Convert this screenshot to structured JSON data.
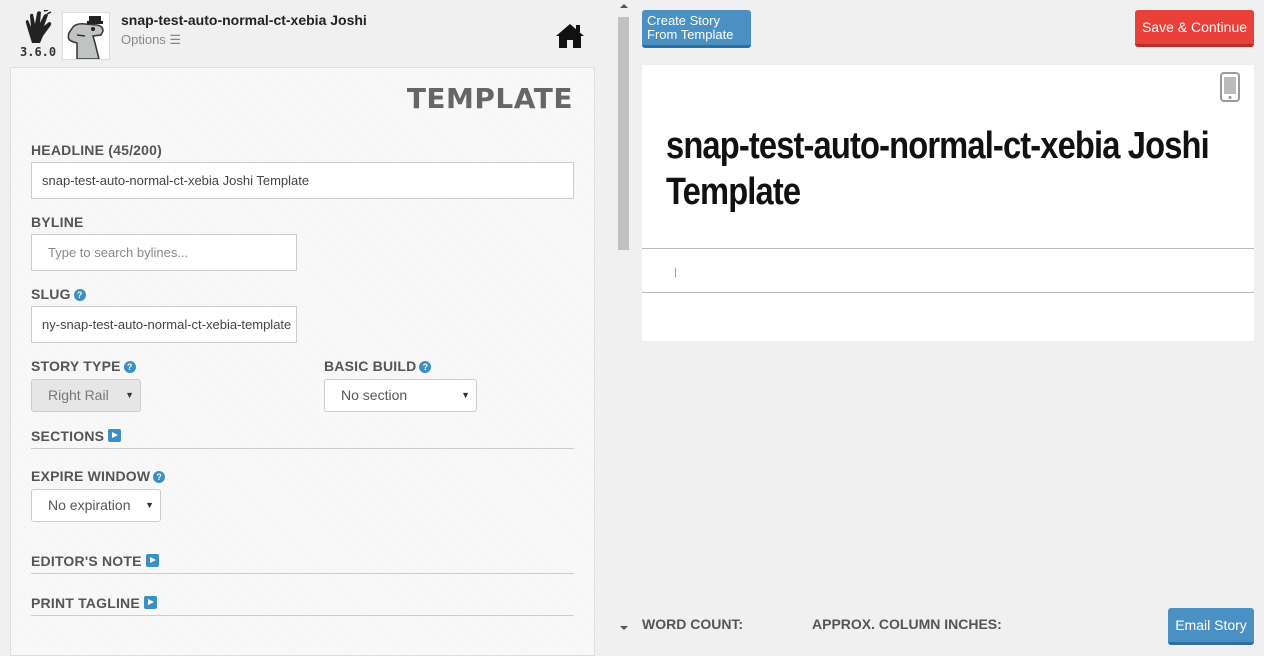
{
  "app": {
    "version": "3.6.0",
    "story_title": "snap-test-auto-normal-ct-xebia Joshi",
    "options_label": "Options ☰"
  },
  "form": {
    "panel_title": "TEMPLATE",
    "headline": {
      "label": "HEADLINE (45/200)",
      "value": "snap-test-auto-normal-ct-xebia Joshi Template"
    },
    "byline": {
      "label": "BYLINE",
      "placeholder": "Type to search bylines..."
    },
    "slug": {
      "label": "SLUG",
      "value": "ny-snap-test-auto-normal-ct-xebia-template"
    },
    "story_type": {
      "label": "STORY TYPE",
      "value": "Right Rail"
    },
    "basic_build": {
      "label": "BASIC BUILD",
      "value": "No section"
    },
    "sections": {
      "label": "SECTIONS"
    },
    "expire_window": {
      "label": "EXPIRE WINDOW",
      "value": "No expiration"
    },
    "editors_note": {
      "label": "EDITOR'S NOTE"
    },
    "print_tagline": {
      "label": "PRINT TAGLINE"
    }
  },
  "toolbar": {
    "create_from_template_line1": "Create Story",
    "create_from_template_line2": "From Template",
    "save_continue": "Save & Continue",
    "email_story": "Email Story"
  },
  "preview": {
    "headline": "snap-test-auto-normal-ct-xebia Joshi Template"
  },
  "footer": {
    "word_count_label": "WORD COUNT:",
    "column_inches_label": "APPROX. COLUMN INCHES:"
  },
  "colors": {
    "accent_blue": "#4a90c2",
    "save_red": "#e9403a",
    "help_blue": "#3a8fc7"
  }
}
